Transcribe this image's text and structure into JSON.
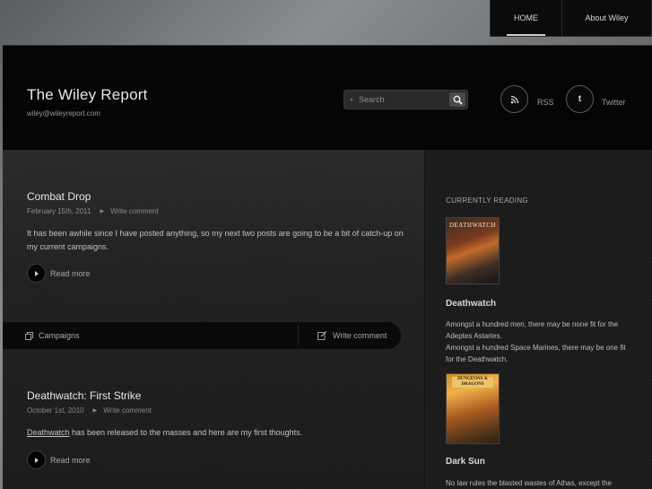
{
  "nav": {
    "home_label": "HOME",
    "about_label": "About Wiley"
  },
  "header": {
    "title": "The Wiley Report",
    "email": "wiley@wileyreport.com",
    "search_placeholder": "Search",
    "rss_label": "RSS",
    "twitter_label": "Twitter",
    "twitter_glyph": "t"
  },
  "posts": [
    {
      "title": "Combat Drop",
      "date": "February 15th, 2011",
      "comment_link": "Write comment",
      "body": "It has been awhile since I have posted anything, so my next two posts are going to be a bit of catch-up on my current campaigns.",
      "read_more": "Read more",
      "category": "Campaigns",
      "footer_comment": "Write comment"
    },
    {
      "title": "Deathwatch: First Strike",
      "date": "October 1st, 2010",
      "comment_link": "Write comment",
      "body_link": "Deathwatch",
      "body_rest": " has been released to the masses and here are my first thoughts.",
      "read_more": "Read more"
    }
  ],
  "sidebar": {
    "heading": "CURRENTLY READING",
    "books": [
      {
        "cover_text": "DEATHWATCH",
        "title": "Deathwatch",
        "desc_1": "Amongst a hundred men, there may be none fit for the Adeptes Astartes.",
        "desc_2": "Amongst a hundred Space Marines, there may be one fit for the Deathwatch."
      },
      {
        "cover_text": "DUNGEONS & DRAGONS",
        "title": "Dark Sun",
        "desc_1": "No law rules the blasted wastes of Athas, except the"
      }
    ]
  },
  "colors": {
    "background_gradient": "#6e7174",
    "header_bg": "#050505",
    "content_bg": "#222222",
    "text_primary": "#e6e6e6",
    "text_muted": "#8a8a8a"
  },
  "icons": [
    "search-icon",
    "rss-icon",
    "twitter-icon",
    "play-arrow-icon",
    "category-icon",
    "edit-icon"
  ]
}
